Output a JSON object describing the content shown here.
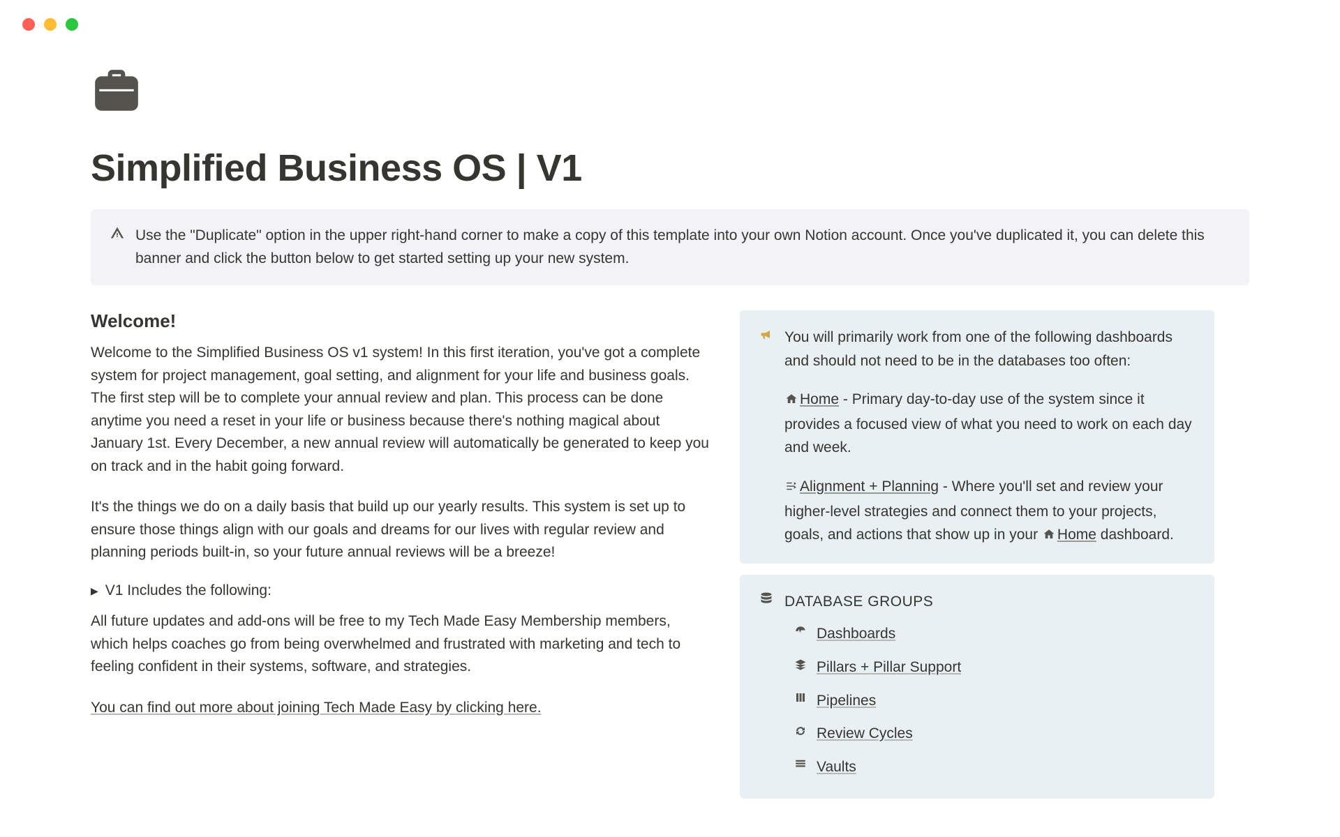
{
  "title": "Simplified Business OS | V1",
  "banner": "Use the \"Duplicate\" option in the upper right-hand corner to make a copy of this template into your own Notion account. Once you've duplicated it, you can delete this banner and click the button below to get started setting up your new system.",
  "welcome_heading": "Welcome!",
  "welcome_p1": "Welcome to the Simplified Business OS v1 system! In this first iteration, you've got a complete system for project management, goal setting, and alignment for your life and business goals. The first step will be to complete your annual review and plan. This process can be done anytime you need a reset in your life or business because there's nothing magical about January 1st. Every December, a new annual review will automatically be generated to keep you on track and in the habit going forward.",
  "welcome_p2": "It's the things we do on a daily basis that build up our yearly results. This system is set up to ensure those things align with our goals and dreams for our lives with regular review and planning periods built-in, so your future annual reviews will be a breeze!",
  "toggle_label": "V1 Includes the following:",
  "updates_p": "All future updates and add-ons will be free to my Tech Made Easy Membership members, which helps coaches go from being overwhelmed and frustrated with marketing and tech to feeling confident in their systems, software, and strategies.",
  "join_link": "You can find out more about joining Tech Made Easy by clicking here.",
  "callout_intro": "You will primarily work from one of the following dashboards and should not need to be in the databases too often:",
  "home_label": "Home",
  "home_desc": " - Primary day-to-day use of the system since it provides a focused view of what you need to work on each day and week.",
  "align_label": "Alignment + Planning",
  "align_desc_1": " - Where you'll set and review your higher-level strategies and connect them to your projects, goals, and actions that show up in your ",
  "align_desc_2": " dashboard.",
  "db_groups_title": "DATABASE GROUPS",
  "db_items": {
    "0": "Dashboards",
    "1": "Pillars + Pillar Support",
    "2": "Pipelines",
    "3": "Review Cycles",
    "4": "Vaults"
  }
}
